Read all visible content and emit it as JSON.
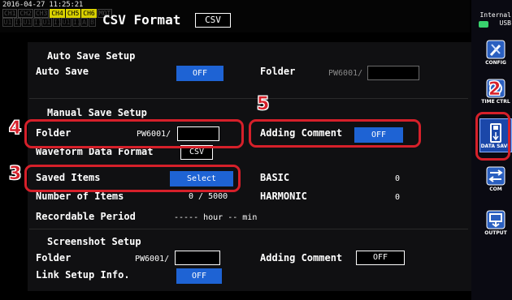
{
  "header": {
    "datetime": "2016-04-27 11:25:21",
    "channels": [
      {
        "label": "CH1",
        "active": false
      },
      {
        "label": "CH2",
        "active": false
      },
      {
        "label": "CH3",
        "active": false
      },
      {
        "label": "CH4",
        "active": true
      },
      {
        "label": "CH5",
        "active": true
      },
      {
        "label": "CH6",
        "active": true
      },
      {
        "label": "MOT",
        "active": false
      }
    ],
    "units": [
      "U1",
      "I1",
      "U1",
      "I1",
      "U1",
      "I1",
      "U1",
      "I1",
      "A",
      "B"
    ],
    "title": "CSV Format",
    "format_value": "CSV"
  },
  "media": {
    "line1": "Internal",
    "line2": "USB"
  },
  "rail": [
    {
      "label": "CONFIG",
      "icon": "wrench-screwdriver-icon"
    },
    {
      "label": "TIME CTRL",
      "icon": "clock-icon"
    },
    {
      "label": "DATA SAVE",
      "icon": "usb-drive-icon"
    },
    {
      "label": "COM",
      "icon": "bidirectional-arrows-icon"
    },
    {
      "label": "OUTPUT",
      "icon": "output-icon"
    }
  ],
  "auto_save": {
    "section_title": "Auto Save Setup",
    "auto_save_label": "Auto Save",
    "auto_save_value": "OFF",
    "folder_label": "Folder",
    "folder_value": "PW6001/"
  },
  "manual_save": {
    "section_title": "Manual Save Setup",
    "folder_label": "Folder",
    "folder_value": "PW6001/",
    "adding_comment_label": "Adding Comment",
    "adding_comment_value": "OFF",
    "waveform_label": "Waveform Data Format",
    "waveform_value": "CSV",
    "saved_items_label": "Saved Items",
    "saved_items_button": "Select",
    "basic_label": "BASIC",
    "basic_value": "0",
    "number_items_label": "Number of Items",
    "number_items_value": "0 / 5000",
    "harmonic_label": "HARMONIC",
    "harmonic_value": "0",
    "recordable_label": "Recordable Period",
    "recordable_value": "----- hour -- min"
  },
  "screenshot": {
    "section_title": "Screenshot Setup",
    "folder_label": "Folder",
    "folder_value": "PW6001/",
    "adding_comment_label": "Adding Comment",
    "adding_comment_value": "OFF",
    "link_label": "Link Setup Info.",
    "link_value": "OFF"
  },
  "callouts": [
    "2",
    "3",
    "4",
    "5"
  ],
  "colors": {
    "accent_blue": "#1e63d4",
    "callout_red": "#d6202a",
    "channel_yellow": "#d8d000"
  }
}
